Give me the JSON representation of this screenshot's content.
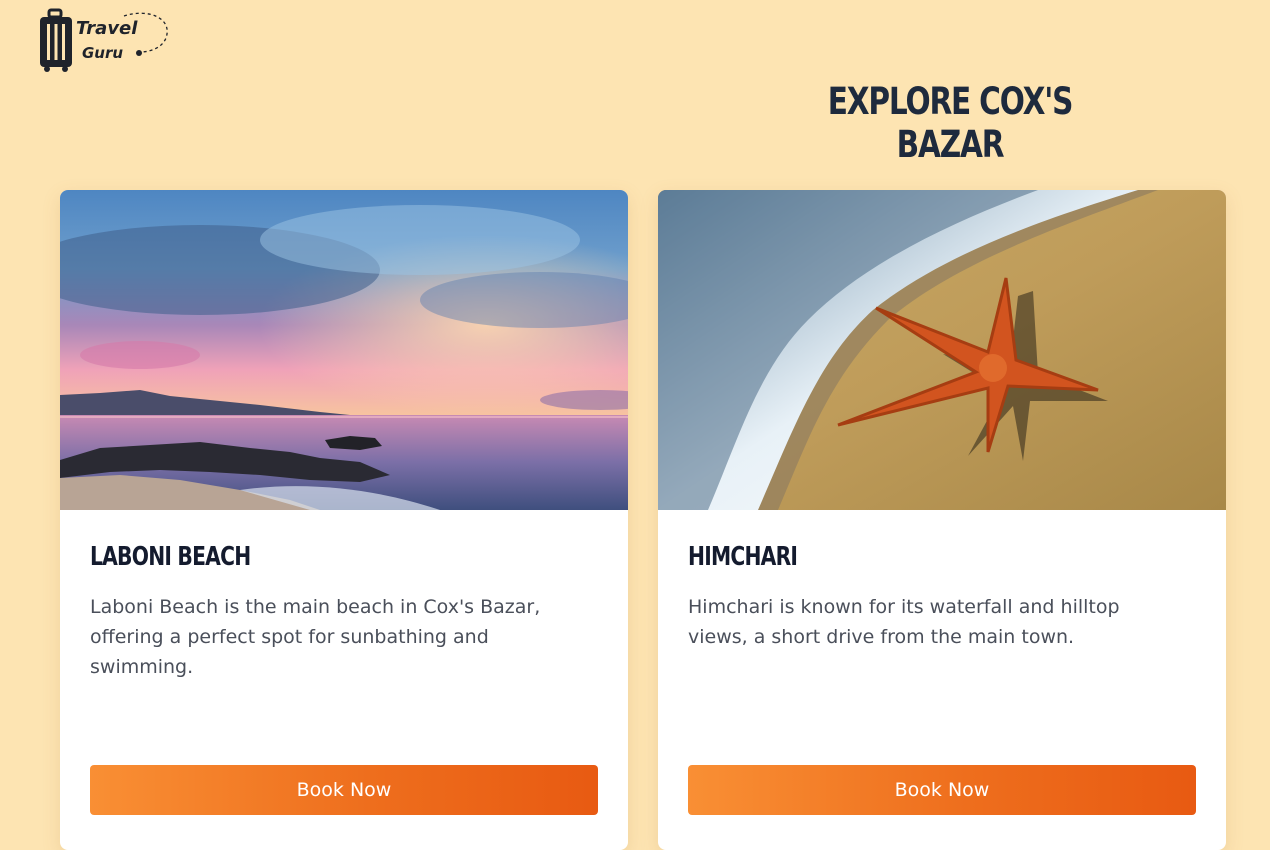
{
  "logo": {
    "line1": "Travel",
    "line2": "Guru"
  },
  "page_title": "EXPLORE COX'S BAZAR",
  "cards": [
    {
      "title": "LABONI BEACH",
      "description": "Laboni Beach is the main beach in Cox's Bazar, offering a perfect spot for sunbathing and swimming.",
      "button_label": "Book Now",
      "image": "sunset-beach-photo"
    },
    {
      "title": "HIMCHARI",
      "description": "Himchari is known for its waterfall and hilltop views, a short drive from the main town.",
      "button_label": "Book Now",
      "image": "starfish-on-sand-photo"
    }
  ],
  "colors": {
    "background": "#fde4b2",
    "title": "#1e2a3d",
    "button_start": "#f98f34",
    "button_end": "#e85a12"
  }
}
